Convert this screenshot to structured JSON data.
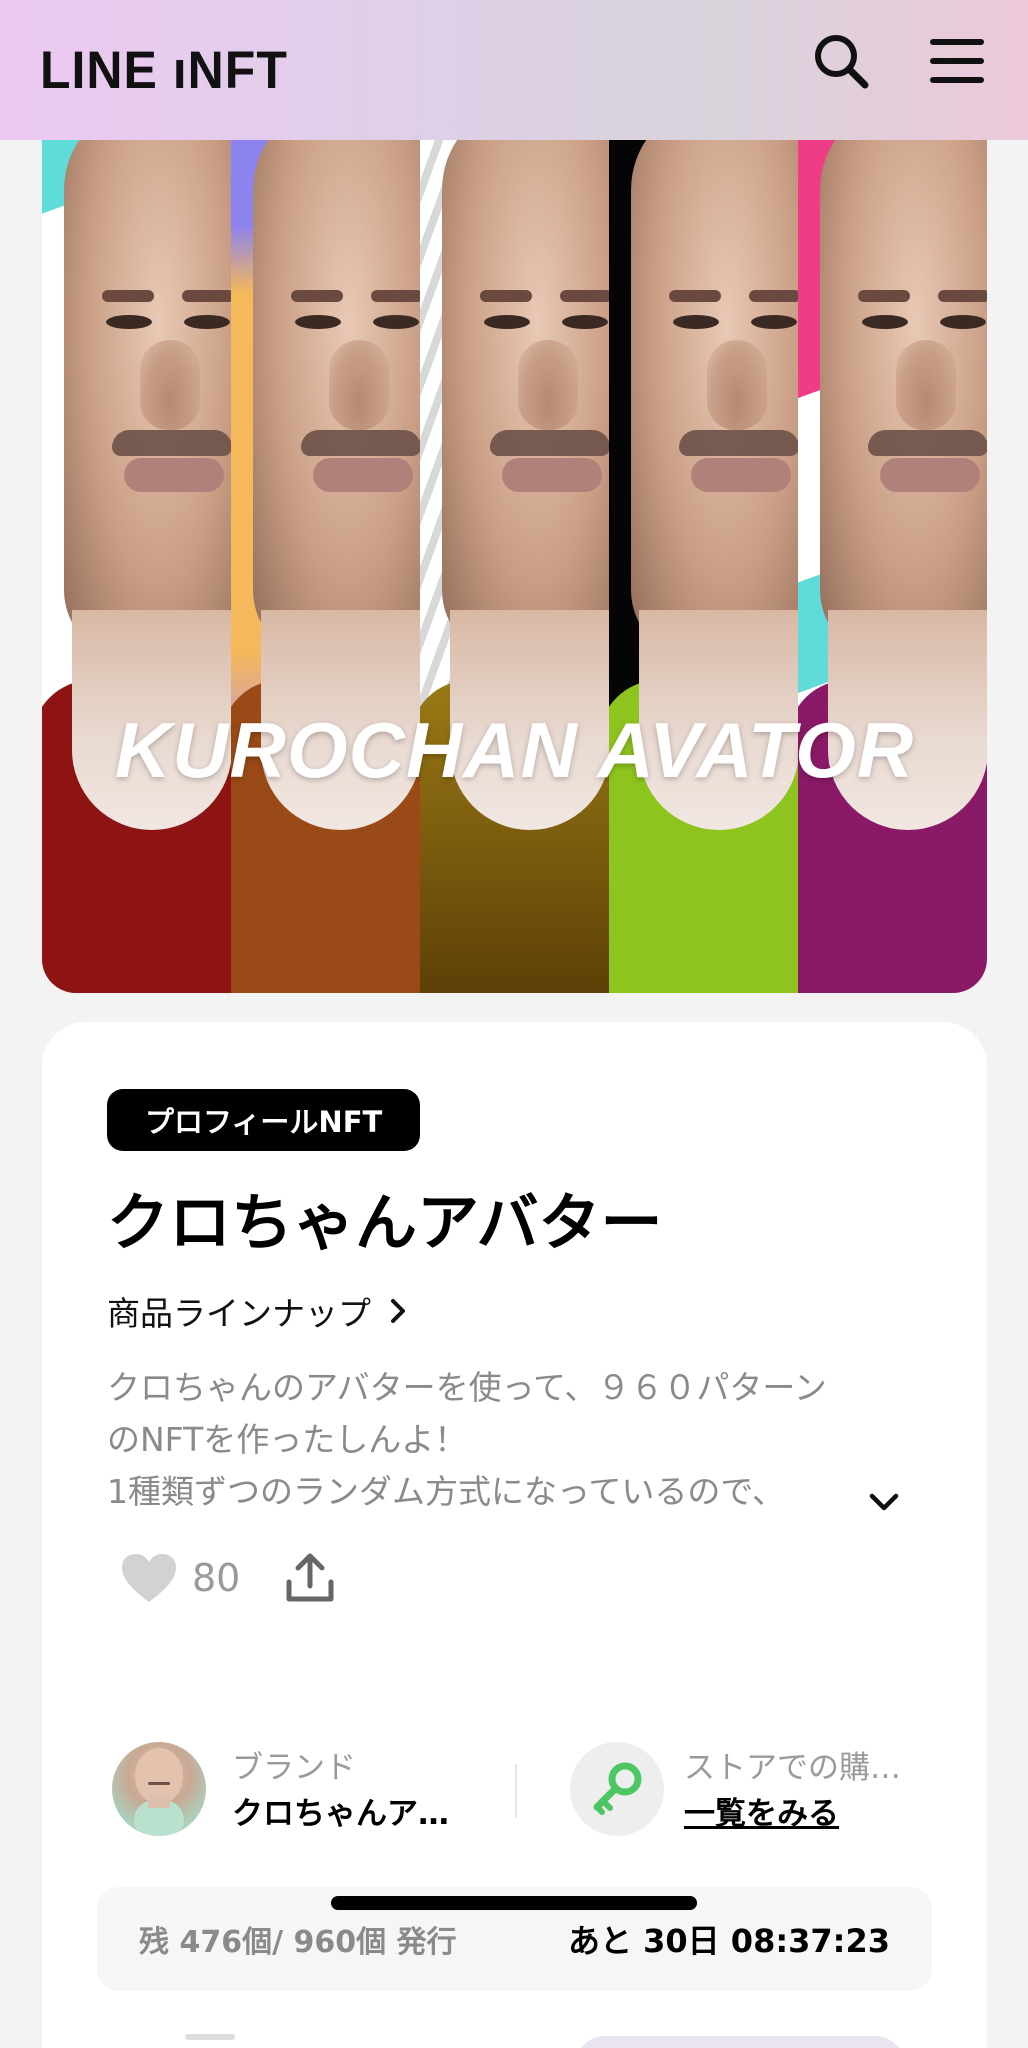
{
  "header": {
    "logo": "LINE ıNFT",
    "icons": [
      "search-icon",
      "menu-icon"
    ]
  },
  "banner": {
    "title": "KUROCHAN AVATOR",
    "panel_colors": [
      {
        "bg": "#ffffff",
        "accent": "#5fdcd9",
        "shirt": "#8e1414",
        "bottom": "#e030e0"
      },
      {
        "bg": "#f5b85a",
        "accent": "#8d83ee",
        "shirt": "#9a4a16",
        "bottom": "#8a3a10"
      },
      {
        "bg": "#e8e8e8",
        "accent": "#bcbcbc",
        "shirt": "#8a6a10",
        "bottom": "#6a4a08"
      },
      {
        "bg": "#050505",
        "accent": "#222222",
        "shirt": "#8ec41e",
        "bottom": "#7aa818"
      },
      {
        "bg": "#ffffff",
        "accent": "#ee3c86",
        "shirt": "#8a1a68",
        "bottom": "#6e0e50"
      }
    ]
  },
  "product": {
    "badge": "プロフィールNFT",
    "title": "クロちゃんアバター",
    "lineup_link": "商品ラインナップ",
    "description": [
      "クロちゃんのアバターを使って、９６０パターン",
      "のNFTを作ったしんよ！",
      "1種類ずつのランダム方式になっているので、"
    ],
    "likes": "80"
  },
  "brand": {
    "label": "ブランド",
    "name": "クロちゃんア…",
    "store_label": "ストアでの購…",
    "store_link": "一覧をみる"
  },
  "stock": {
    "remaining": "残 476個/ 960個 発行",
    "countdown": "あと 30日 08:37:23"
  },
  "colors": {
    "accent_green": "#4cc764",
    "text_gray": "#8a8a8a"
  }
}
